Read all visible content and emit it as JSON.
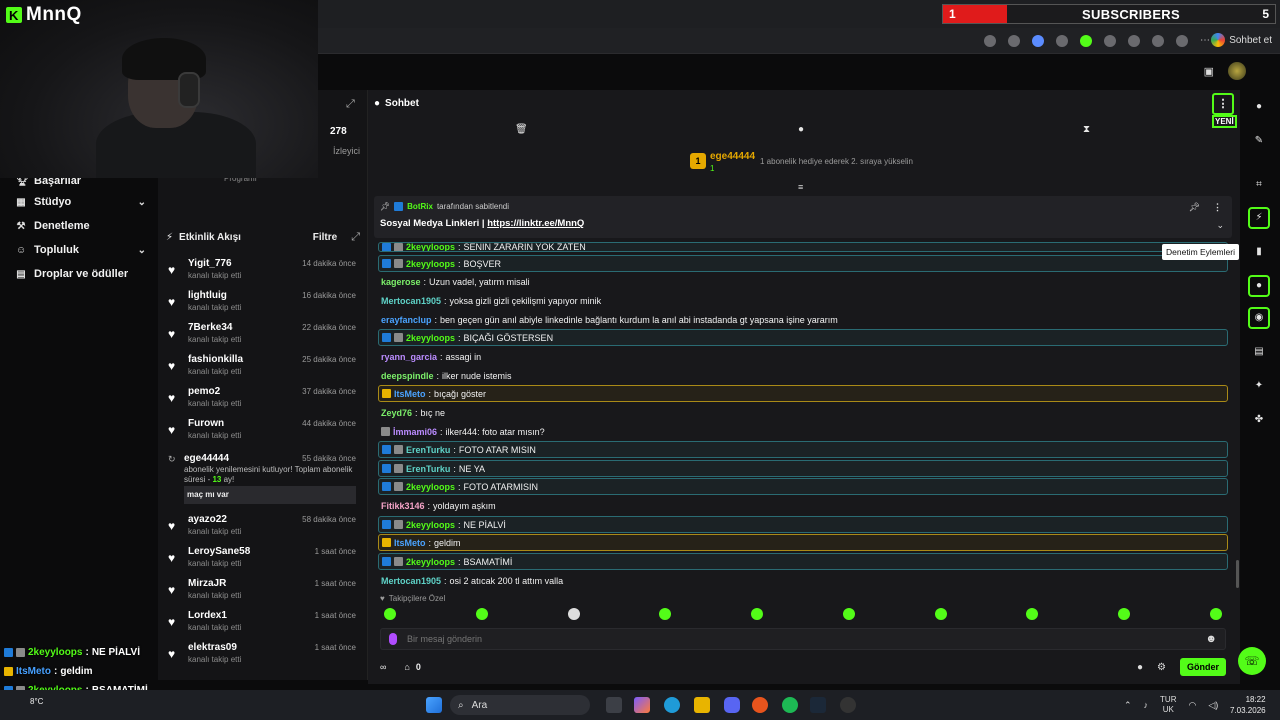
{
  "brand": {
    "name": "MnnQ",
    "logo_letter": "K"
  },
  "subscribers_widget": {
    "current": "1",
    "label": "SUBSCRIBERS",
    "goal": "5"
  },
  "browser": {
    "sidebar_button": "Sohbet et"
  },
  "stream_stats": {
    "viewers": "278",
    "viewers_label": "İzleyici",
    "program_label": "Programı"
  },
  "nav": {
    "items": [
      {
        "label": "Başarılar",
        "icon": "trophy-icon"
      },
      {
        "label": "Stüdyo",
        "icon": "studio-icon",
        "expandable": true
      },
      {
        "label": "Denetleme",
        "icon": "hammer-icon"
      },
      {
        "label": "Topluluk",
        "icon": "community-icon",
        "expandable": true
      },
      {
        "label": "Droplar ve ödüller",
        "icon": "gift-icon"
      }
    ]
  },
  "activity": {
    "title": "Etkinlik Akışı",
    "filter_label": "Filtre",
    "items": [
      {
        "name": "Yigit_776",
        "action": "kanalı takip etti",
        "time": "14 dakika önce"
      },
      {
        "name": "lightluig",
        "action": "kanalı takip etti",
        "time": "16 dakika önce"
      },
      {
        "name": "7Berke34",
        "action": "kanalı takip etti",
        "time": "22 dakika önce"
      },
      {
        "name": "fashionkilla",
        "action": "kanalı takip etti",
        "time": "25 dakika önce"
      },
      {
        "name": "pemo2",
        "action": "kanalı takip etti",
        "time": "37 dakika önce"
      },
      {
        "name": "Furown",
        "action": "kanalı takip etti",
        "time": "44 dakika önce"
      }
    ],
    "resub": {
      "name": "ege44444",
      "time": "55 dakika önce",
      "text_before": "abonelik yenilemesini kutluyor! Toplam abonelik süresi - ",
      "months": "13",
      "text_after": " ay!",
      "message": "maç mı var"
    },
    "items_after": [
      {
        "name": "ayazo22",
        "action": "kanalı takip etti",
        "time": "58 dakika önce"
      },
      {
        "name": "LeroySane58",
        "action": "kanalı takip etti",
        "time": "1 saat önce"
      },
      {
        "name": "MirzaJR",
        "action": "kanalı takip etti",
        "time": "1 saat önce"
      },
      {
        "name": "Lordex1",
        "action": "kanalı takip etti",
        "time": "1 saat önce"
      },
      {
        "name": "elektras09",
        "action": "kanalı takip etti",
        "time": "1 saat önce"
      }
    ]
  },
  "overlay_chat": [
    {
      "user": "2keyyloops",
      "text": "NE PİALVİ",
      "color": "#53fc18"
    },
    {
      "user": "ItsMeto",
      "text": "geldim",
      "color": "#47a0ff"
    },
    {
      "user": "2keyyloops",
      "text": "BSAMATİMİ",
      "color": "#53fc18"
    },
    {
      "user": "Mertocan1905",
      "text": "osi 2 atıcak 200 tl attım valla",
      "color": "#47a0ff"
    }
  ],
  "chat": {
    "title": "Sohbet",
    "menu_new_label": "YENİ",
    "gifter": {
      "rank": "1",
      "name": "ege44444",
      "count": "1",
      "hint": "1 abonelik hediye ederek 2. sıraya yükselin"
    },
    "pinned": {
      "pinned_by": "BotRix",
      "pinned_suffix": "tarafından sabitlendi",
      "text": "Sosyal Medya Linkleri | ",
      "link": "https://linktr.ee/MnnQ"
    },
    "messages": [
      {
        "user": "2keyyloops",
        "text": "SENİN ZARARIN YOK ZATEN",
        "style": "hl",
        "color": "c-green",
        "badges": "kb"
      },
      {
        "user": "2keyyloops",
        "text": "BOŞVER",
        "style": "hl",
        "color": "c-green",
        "badges": "kb"
      },
      {
        "user": "kagerose",
        "text": "Uzun vadel, yatırm misali",
        "style": "",
        "color": "c-lgreen",
        "badges": ""
      },
      {
        "user": "Mertocan1905",
        "text": "yoksa gizli gizli çekilişmi yapıyor minik",
        "style": "",
        "color": "c-teal",
        "badges": ""
      },
      {
        "user": "erayfanclup",
        "text": "ben geçen gün anıl abiyle linkedinle bağlantı kurdum la anıl abi instadanda gt yapsana işine yararım",
        "style": "",
        "color": "c-blue",
        "badges": ""
      },
      {
        "user": "2keyyloops",
        "text": "BIÇAĞI GÖSTERSEN",
        "style": "hl",
        "color": "c-green",
        "badges": "kb"
      },
      {
        "user": "ryann_garcia",
        "text": "assagi in",
        "style": "",
        "color": "c-purple",
        "badges": ""
      },
      {
        "user": "deepspindle",
        "text": "ilker nude istemis",
        "style": "",
        "color": "c-lgreen",
        "badges": ""
      },
      {
        "user": "ItsMeto",
        "text": "bıçağı göster",
        "style": "hy",
        "color": "c-blue",
        "badges": "y"
      },
      {
        "user": "Zeyd76",
        "text": "bıç ne",
        "style": "",
        "color": "c-lgreen",
        "badges": ""
      },
      {
        "user": "İmmami06",
        "text": "ilker444: foto atar mısın?",
        "style": "",
        "color": "c-purple",
        "badges": "b"
      },
      {
        "user": "ErenTurku",
        "text": "FOTO ATAR MISIN",
        "style": "hl",
        "color": "c-teal",
        "badges": "kb"
      },
      {
        "user": "ErenTurku",
        "text": "NE YA",
        "style": "hl",
        "color": "c-teal",
        "badges": "kb"
      },
      {
        "user": "2keyyloops",
        "text": "FOTO ATARMISIN",
        "style": "hl",
        "color": "c-green",
        "badges": "kb"
      },
      {
        "user": "Fitikk3146",
        "text": "yoldayım aşkım",
        "style": "",
        "color": "c-pink",
        "badges": ""
      },
      {
        "user": "2keyyloops",
        "text": "NE PİALVİ",
        "style": "hl",
        "color": "c-green",
        "badges": "kb"
      },
      {
        "user": "ItsMeto",
        "text": "geldim",
        "style": "hy",
        "color": "c-blue",
        "badges": "y"
      },
      {
        "user": "2keyyloops",
        "text": "BSAMATİMİ",
        "style": "hl",
        "color": "c-green",
        "badges": "kb"
      },
      {
        "user": "Mertocan1905",
        "text": "osi 2 atıcak 200 tl attım valla",
        "style": "",
        "color": "c-teal",
        "badges": ""
      }
    ],
    "followers_only_label": "Takipçilere Özel",
    "input_placeholder": "Bir mesaj gönderin",
    "points": "0",
    "send_label": "Gönder"
  },
  "tooltip": "Denetim Eylemleri",
  "taskbar": {
    "search_placeholder": "Ara",
    "weather": "8°C",
    "lang_line1": "TUR",
    "lang_line2": "UK",
    "time": "18:22",
    "date": "7.03.2026"
  },
  "colors": {
    "accent": "#53fc18",
    "subs_bar": "#e01b1b",
    "highlight_border": "#2a6b73",
    "vip_border": "#a98a17"
  }
}
